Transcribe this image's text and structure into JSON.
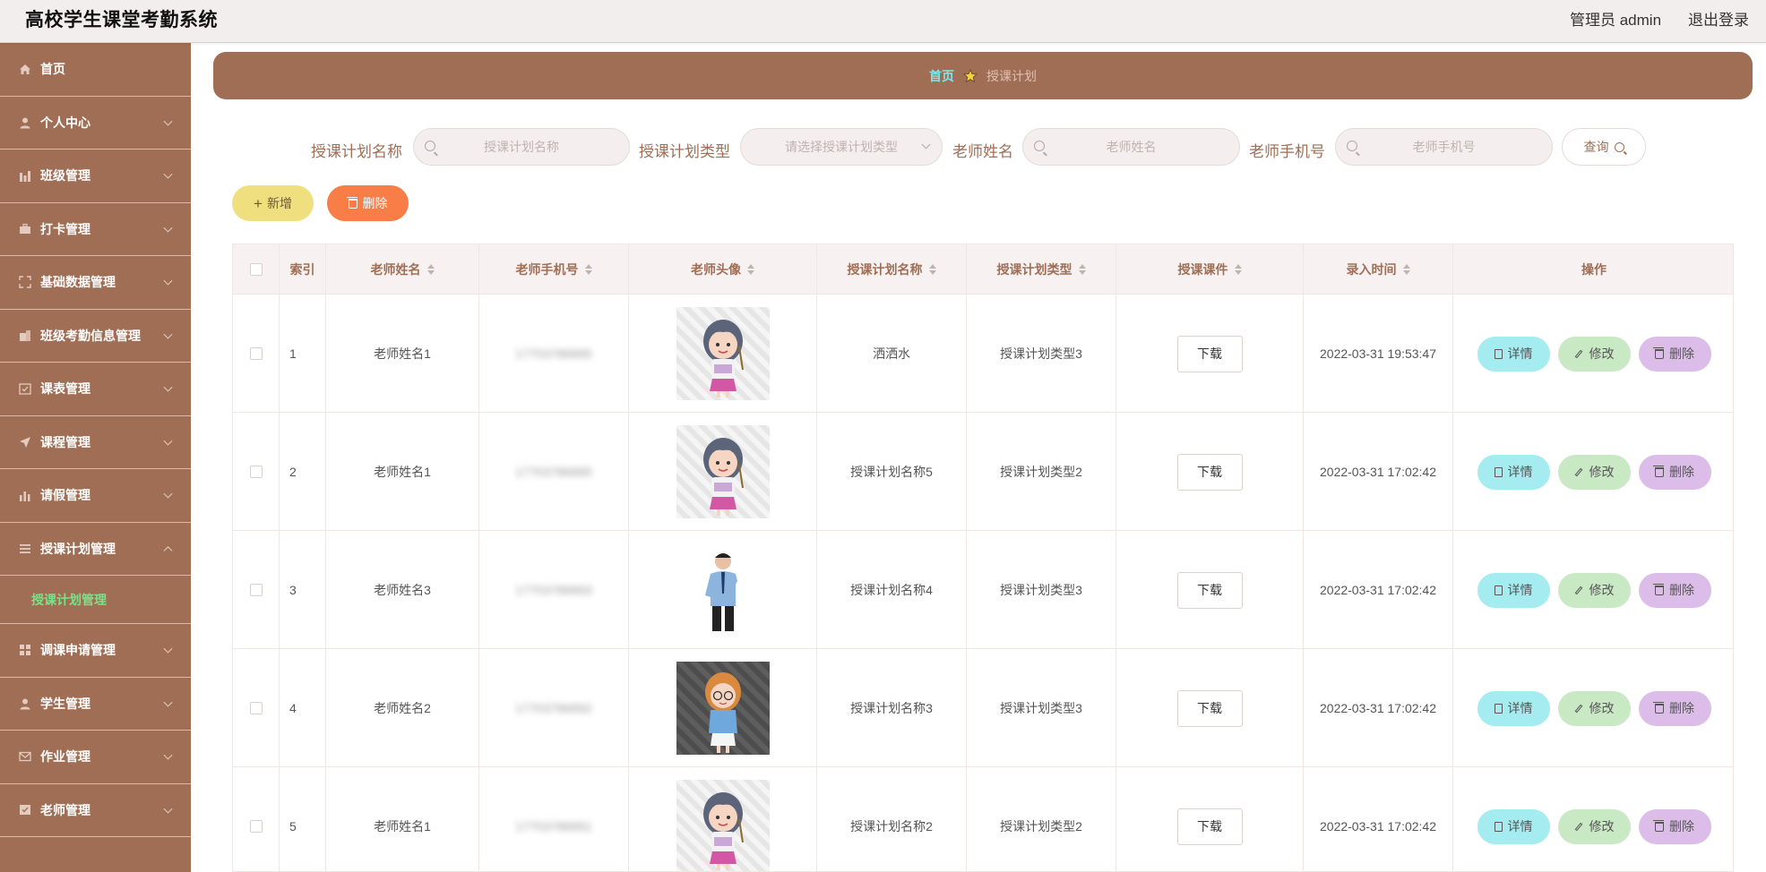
{
  "header": {
    "title": "高校学生课堂考勤系统",
    "user": "管理员 admin",
    "logout": "退出登录"
  },
  "sidebar": {
    "items": [
      {
        "label": "首页",
        "icon": "home-icon"
      },
      {
        "label": "个人中心",
        "icon": "user-icon"
      },
      {
        "label": "班级管理",
        "icon": "bar-chart-icon"
      },
      {
        "label": "打卡管理",
        "icon": "briefcase-icon"
      },
      {
        "label": "基础数据管理",
        "icon": "fullscreen-icon"
      },
      {
        "label": "班级考勤信息管理",
        "icon": "office-icon"
      },
      {
        "label": "课表管理",
        "icon": "checkbox-icon"
      },
      {
        "label": "课程管理",
        "icon": "send-icon"
      },
      {
        "label": "请假管理",
        "icon": "bar-chart-icon"
      },
      {
        "label": "授课计划管理",
        "icon": "list-icon"
      },
      {
        "label": "调课申请管理",
        "icon": "grid-icon"
      },
      {
        "label": "学生管理",
        "icon": "user-icon"
      },
      {
        "label": "作业管理",
        "icon": "mail-icon"
      },
      {
        "label": "老师管理",
        "icon": "checked-icon"
      }
    ],
    "active_sub": "授课计划管理"
  },
  "breadcrumb": {
    "home": "首页",
    "current": "授课计划"
  },
  "search": {
    "fields": [
      {
        "label": "授课计划名称",
        "placeholder": "授课计划名称"
      },
      {
        "label": "授课计划类型",
        "placeholder": "请选择授课计划类型"
      },
      {
        "label": "老师姓名",
        "placeholder": "老师姓名"
      },
      {
        "label": "老师手机号",
        "placeholder": "老师手机号"
      }
    ],
    "query_label": "查询"
  },
  "actions": {
    "add": "新增",
    "delete": "删除"
  },
  "table": {
    "columns": [
      "",
      "索引",
      "老师姓名",
      "老师手机号",
      "老师头像",
      "授课计划名称",
      "授课计划类型",
      "授课课件",
      "录入时间",
      "操作"
    ],
    "rows": [
      {
        "index": "1",
        "teacher": "老师姓名1",
        "phone": "17703786895",
        "avatar": "cartoon-woman-teacher",
        "plan_name": "洒洒水",
        "plan_type": "授课计划类型3",
        "download": "下载",
        "time": "2022-03-31 19:53:47"
      },
      {
        "index": "2",
        "teacher": "老师姓名1",
        "phone": "17703786895",
        "avatar": "cartoon-woman-teacher",
        "plan_name": "授课计划名称5",
        "plan_type": "授课计划类型2",
        "download": "下载",
        "time": "2022-03-31 17:02:42"
      },
      {
        "index": "3",
        "teacher": "老师姓名3",
        "phone": "17703786893",
        "avatar": "man-teacher-photo",
        "plan_name": "授课计划名称4",
        "plan_type": "授课计划类型3",
        "download": "下载",
        "time": "2022-03-31 17:02:42"
      },
      {
        "index": "4",
        "teacher": "老师姓名2",
        "phone": "17703786892",
        "avatar": "cartoon-girl-glasses",
        "plan_name": "授课计划名称3",
        "plan_type": "授课计划类型3",
        "download": "下载",
        "time": "2022-03-31 17:02:42"
      },
      {
        "index": "5",
        "teacher": "老师姓名1",
        "phone": "17703786891",
        "avatar": "cartoon-woman-teacher",
        "plan_name": "授课计划名称2",
        "plan_type": "授课计划类型2",
        "download": "下载",
        "time": "2022-03-31 17:02:42"
      }
    ],
    "op_labels": {
      "detail": "详情",
      "edit": "修改",
      "remove": "删除"
    }
  },
  "colors": {
    "brand": "#a06e55",
    "active_sub": "#7ee08a",
    "crumb_home": "#7fe6ec",
    "add": "#f0df7e",
    "delete": "#f97d47",
    "detail": "#a4ecef",
    "edit": "#c9e8c4",
    "remove": "#dcbde9"
  }
}
